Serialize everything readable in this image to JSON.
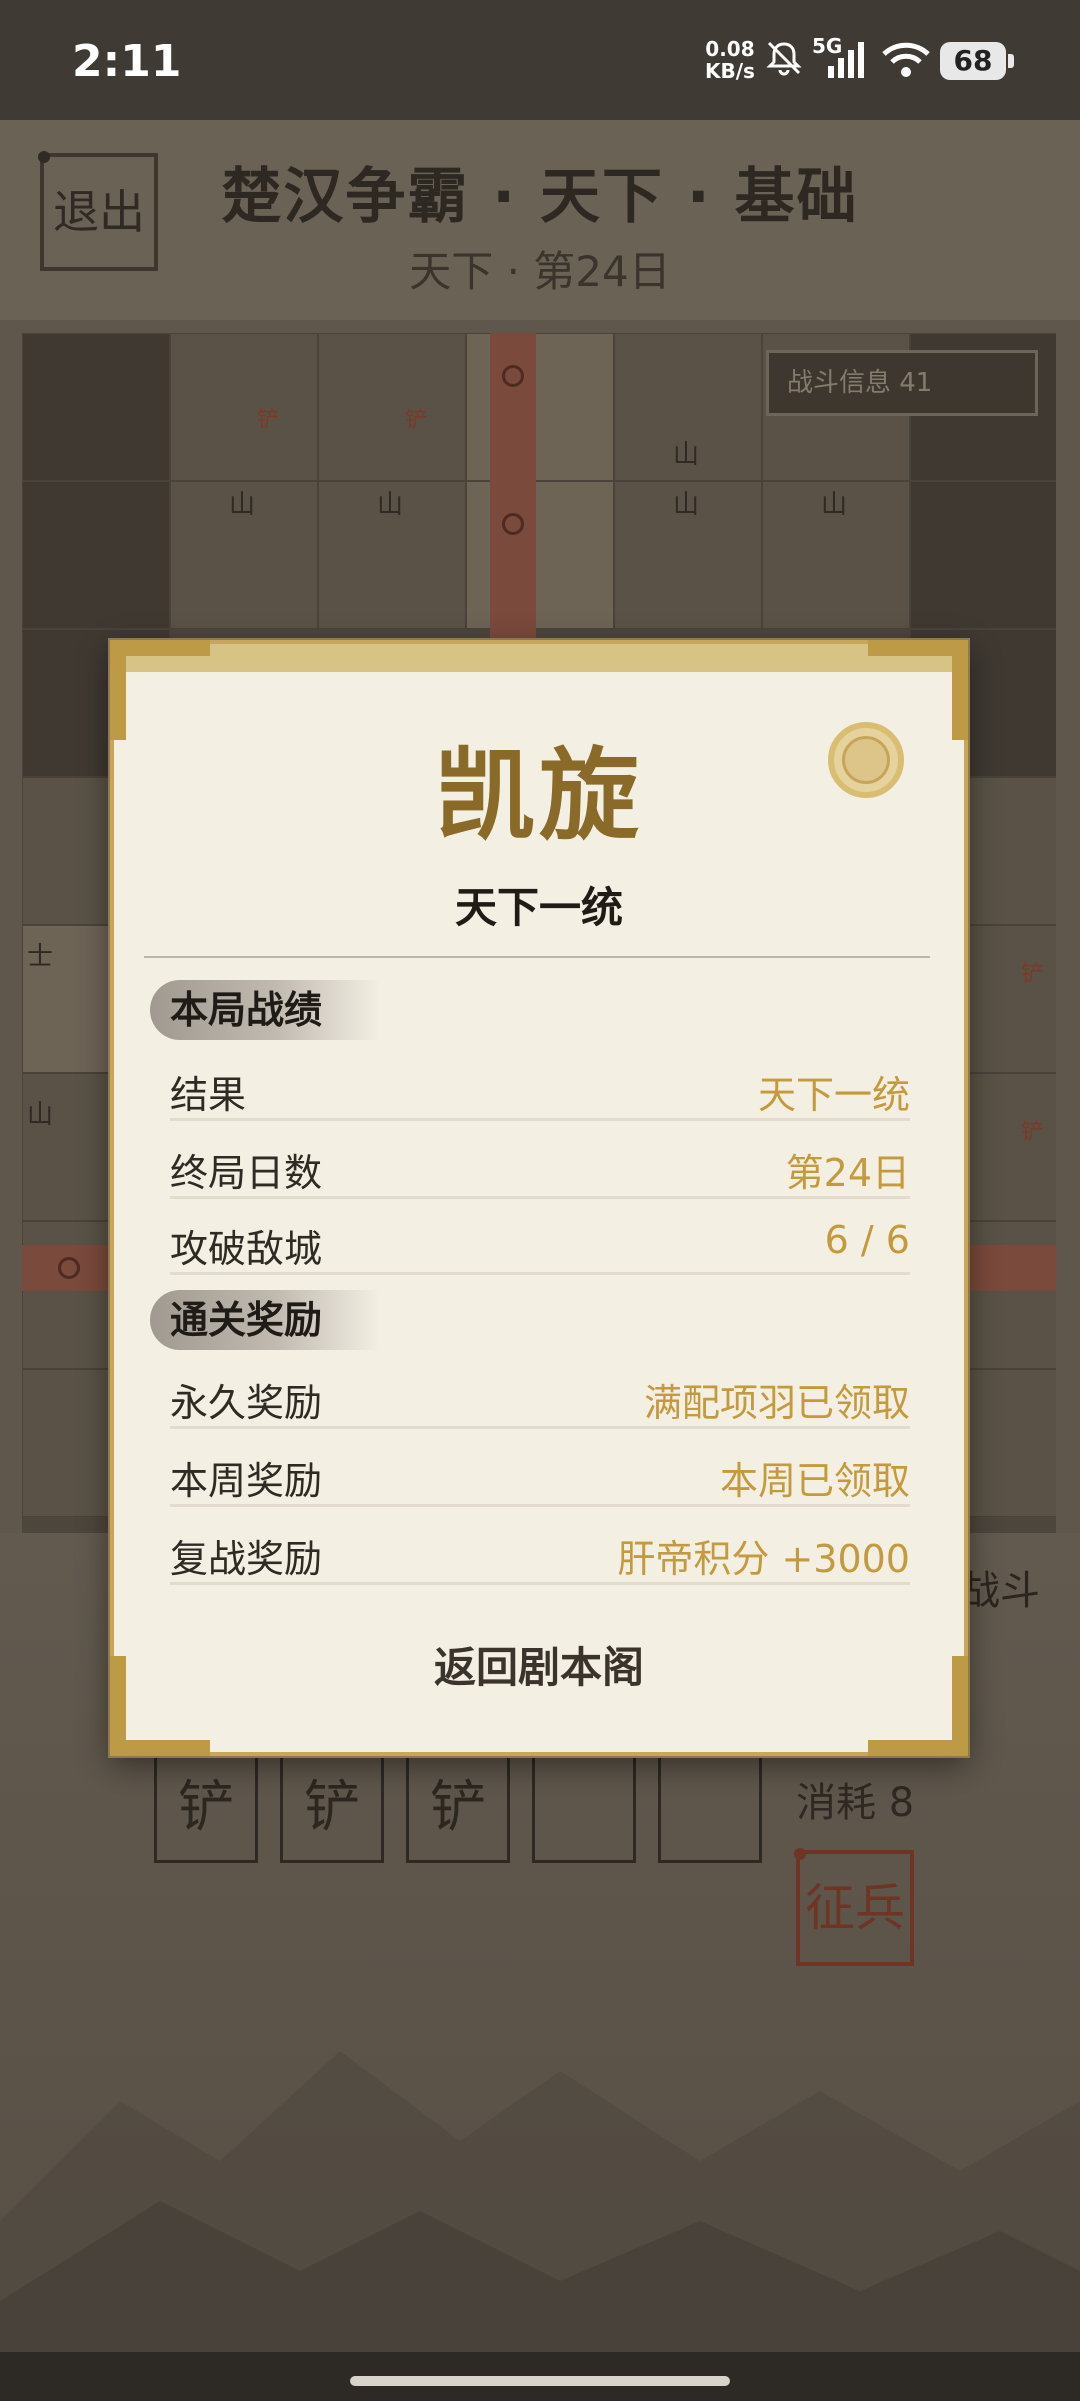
{
  "status_bar": {
    "time": "2:11",
    "net_speed": "0.08",
    "net_unit": "KB/s",
    "signal_label": "5G",
    "battery": "68"
  },
  "header": {
    "exit_label": "退出",
    "title": "楚汉争霸 · 天下 · 基础",
    "subtitle": "天下 · 第24日"
  },
  "board": {
    "battle_info": "战斗信息 41",
    "mountain_char": "山",
    "shovel_char": "铲",
    "soldier_char": "士"
  },
  "bottom": {
    "slots": [
      "铲",
      "铲",
      "铲",
      "",
      ""
    ],
    "cost": "消耗 8",
    "recruit": "征兵",
    "auto_battle": "战斗"
  },
  "dialog": {
    "title": "凯旋",
    "subtitle": "天下一统",
    "section1": {
      "heading": "本局战绩",
      "rows": [
        {
          "label": "结果",
          "value": "天下一统"
        },
        {
          "label": "终局日数",
          "value": "第24日"
        },
        {
          "label": "攻破敌城",
          "value": "6 / 6"
        }
      ]
    },
    "section2": {
      "heading": "通关奖励",
      "rows": [
        {
          "label": "永久奖励",
          "value": "满配项羽已领取"
        },
        {
          "label": "本周奖励",
          "value": "本周已领取"
        },
        {
          "label": "复战奖励",
          "value": "肝帝积分 +3000"
        }
      ]
    },
    "return_label": "返回剧本阁"
  },
  "colors": {
    "accent_gold": "#c49a3e",
    "title_gold": "#8a6a28",
    "dialog_bg": "#f4efe3",
    "overlay": "#5f574b",
    "recruit_red": "#6e3525"
  }
}
